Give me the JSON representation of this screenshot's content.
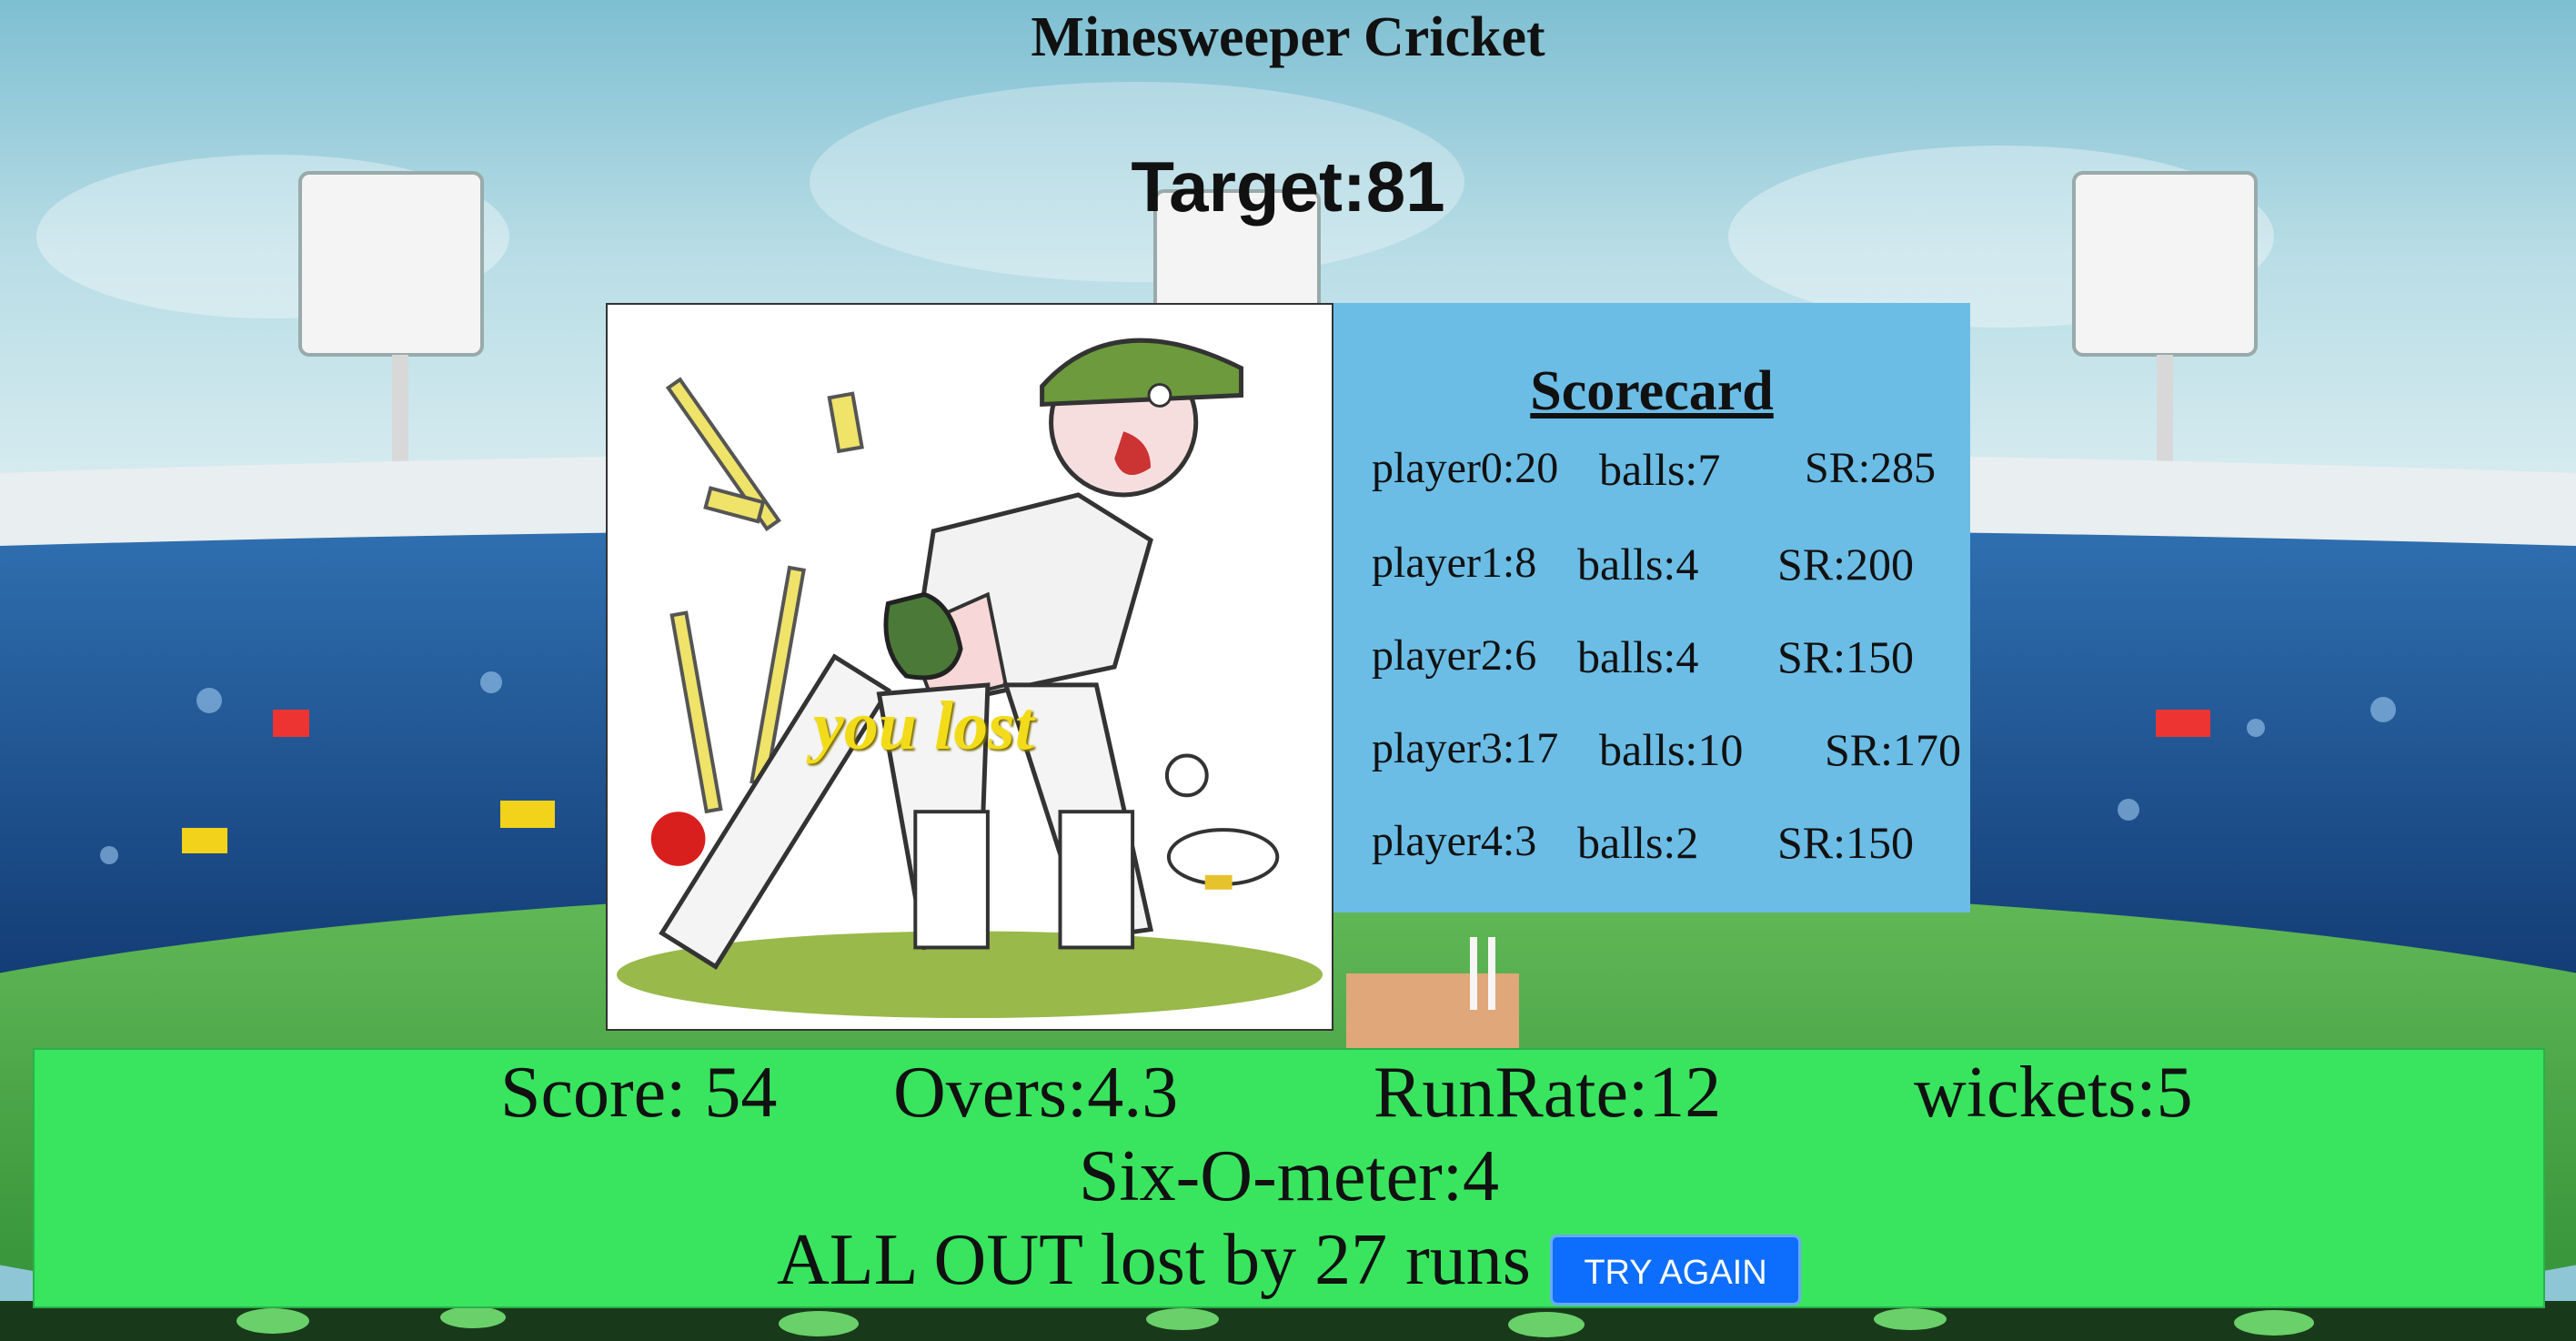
{
  "game": {
    "title": "Minesweeper Cricket",
    "target": "Target:81",
    "result_overlay": "you lost"
  },
  "scorecard": {
    "title": "Scorecard",
    "rows": [
      {
        "name": "player0:20",
        "balls": "balls:7",
        "sr": "SR:285"
      },
      {
        "name": "player1:8",
        "balls": "balls:4",
        "sr": "SR:200"
      },
      {
        "name": "player2:6",
        "balls": "balls:4",
        "sr": "SR:150"
      },
      {
        "name": "player3:17",
        "balls": "balls:10",
        "sr": "SR:170"
      },
      {
        "name": "player4:3",
        "balls": "balls:2",
        "sr": "SR:150"
      }
    ]
  },
  "status": {
    "score": "Score: 54",
    "overs": "Overs:4.3",
    "run_rate": "RunRate:12",
    "wickets": "wickets:5",
    "six_o_meter": "Six-O-meter:4",
    "result": "ALL OUT lost by 27 runs",
    "try_again_label": "TRY AGAIN"
  },
  "colors": {
    "scorecard_bg": "#6bbde6",
    "status_bg": "#39e55f",
    "button_bg": "#0d6efd",
    "overlay_text": "#f2dc1a"
  }
}
